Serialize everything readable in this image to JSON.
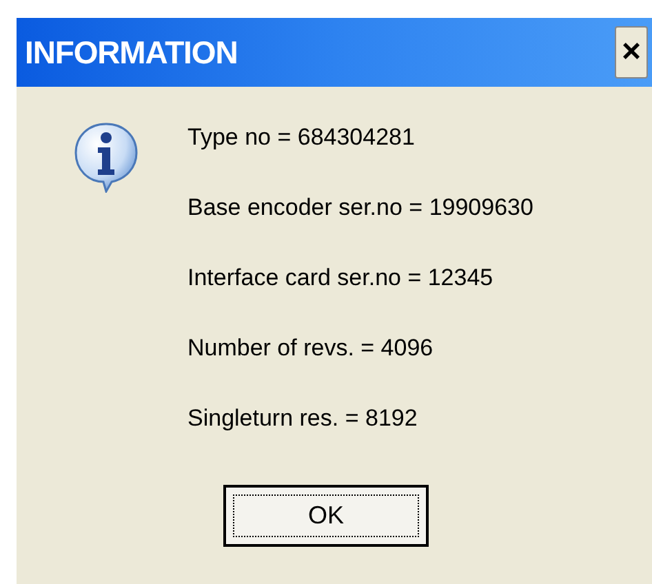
{
  "window": {
    "title": "INFORMATION",
    "close": "×"
  },
  "lines": [
    "Type no = 684304281",
    "Base encoder ser.no = 19909630",
    "Interface card ser.no = 12345",
    "Number of revs. = 4096",
    "Singleturn res. = 8192"
  ],
  "buttons": [
    "OK"
  ]
}
